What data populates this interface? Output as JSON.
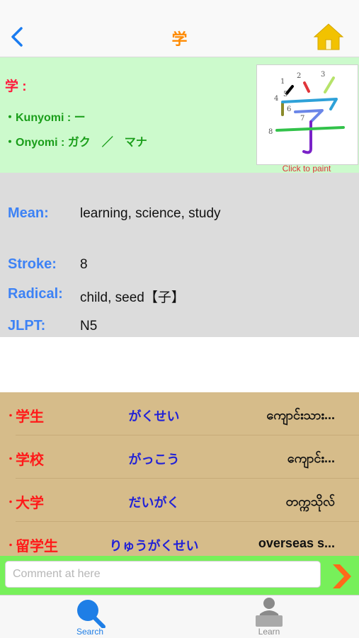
{
  "nav": {
    "title": "学",
    "icons": {
      "back": "chevron-left-icon",
      "home": "home-icon"
    },
    "colors": {
      "back": "#1a7cf0",
      "title": "#ff8a00",
      "home": "#f2c200"
    }
  },
  "kanji": {
    "heading": "学 :",
    "kunyomi": "・Kunyomi : ー",
    "onyomi": "・Onyomi : ガク　／　マナ",
    "stroke_numbers": [
      "1",
      "2",
      "3",
      "4",
      "5",
      "6",
      "7",
      "8"
    ],
    "glyph": "学",
    "click_to_paint": "Click to paint"
  },
  "details": {
    "mean_label": "Mean:",
    "mean_value": "learning, science, study",
    "stroke_label": "Stroke:",
    "stroke_value": "8",
    "radical_label": "Radical:",
    "radical_value": "child, seed【子】",
    "jlpt_label": "JLPT:",
    "jlpt_value": "N5"
  },
  "words": [
    {
      "bullet": "・",
      "kanji": "学生",
      "kana": "がくせい",
      "meaning": "ကျောင်းသား..."
    },
    {
      "bullet": "・",
      "kanji": "学校",
      "kana": "がっこう",
      "meaning": "ကျောင်း..."
    },
    {
      "bullet": "・",
      "kanji": "大学",
      "kana": "だいがく",
      "meaning": "တက္ကသိုလ်"
    },
    {
      "bullet": "・",
      "kanji": "留学生",
      "kana": "りゅうがくせい",
      "meaning": "overseas s..."
    }
  ],
  "comment": {
    "placeholder": "Comment at here",
    "send_icon": "arrow-right-icon"
  },
  "tabs": [
    {
      "label": "Search",
      "icon": "search-icon",
      "active": true
    },
    {
      "label": "Learn",
      "icon": "learn-person-icon",
      "active": false
    }
  ],
  "colors": {
    "info_bg": "#ccfacc",
    "details_bg": "#dcdcdc",
    "words_bg": "#d6bc8a",
    "comment_bg": "#77f05a",
    "accent_blue": "#3d82f5"
  }
}
